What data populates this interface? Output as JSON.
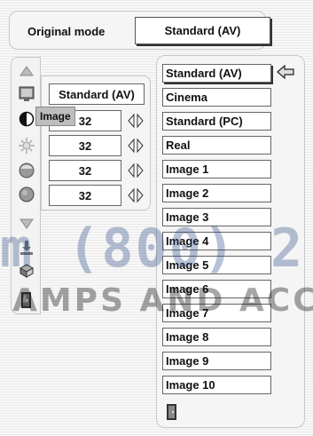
{
  "header": {
    "label": "Original mode",
    "value": "Standard (AV)"
  },
  "toolbar": {
    "tooltip": "Image",
    "icons": [
      "up-arrow-icon",
      "monitor-icon",
      "contrast-icon",
      "brightness-icon",
      "color-icon",
      "tint-icon",
      "down-arrow-icon",
      "store-icon",
      "reset-icon",
      "exit-icon"
    ]
  },
  "adjust": {
    "mode": "Standard (AV)",
    "values": [
      "32",
      "32",
      "32",
      "32"
    ]
  },
  "list": {
    "items": [
      "Standard (AV)",
      "Cinema",
      "Standard (PC)",
      "Real",
      "Image 1",
      "Image 2",
      "Image 3",
      "Image 4",
      "Image 5",
      "Image 6",
      "Image 7",
      "Image 8",
      "Image 9",
      "Image 10"
    ],
    "selected_index": 0
  },
  "watermark": {
    "line1": "m (800) 2",
    "line2": "AMPS AND ACC"
  }
}
